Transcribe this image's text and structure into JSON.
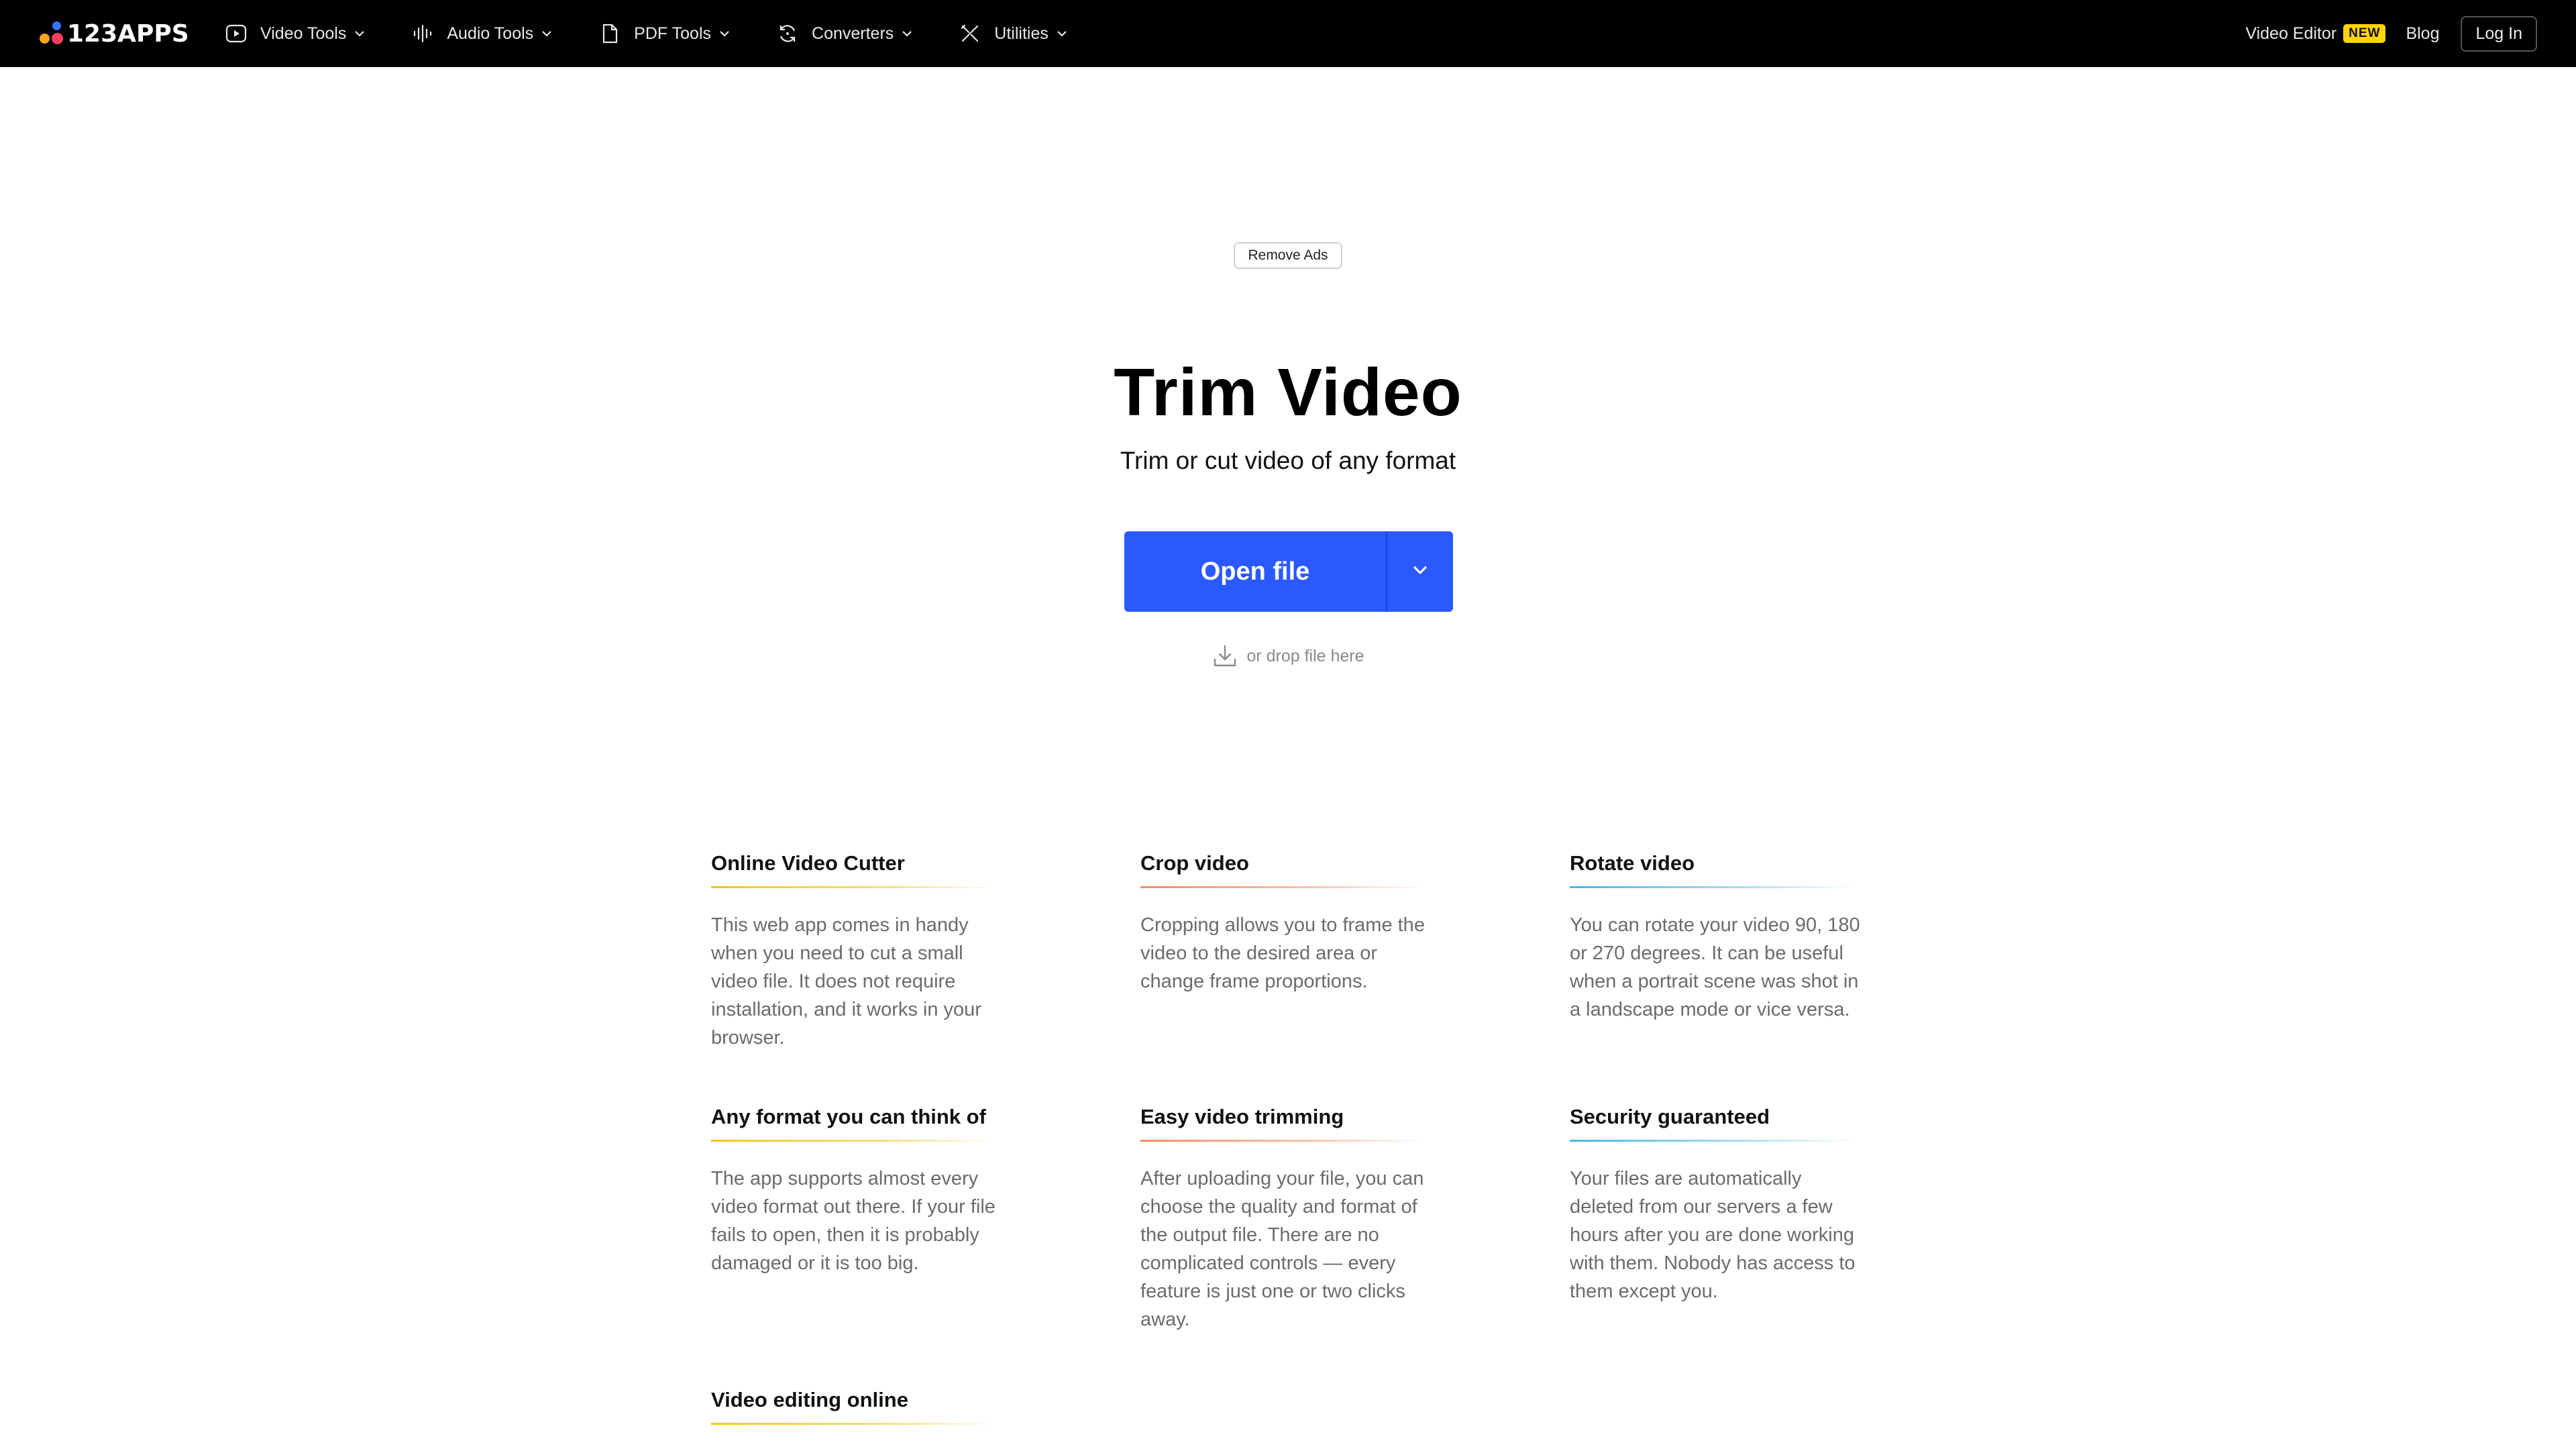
{
  "nav": {
    "logo": "123APPS",
    "menu": [
      {
        "label": "Video Tools",
        "icon": "video-play-icon"
      },
      {
        "label": "Audio Tools",
        "icon": "audio-wave-icon"
      },
      {
        "label": "PDF Tools",
        "icon": "document-icon"
      },
      {
        "label": "Converters",
        "icon": "convert-cycle-icon"
      },
      {
        "label": "Utilities",
        "icon": "tools-icon"
      }
    ],
    "video_editor": "Video Editor",
    "new_badge": "NEW",
    "blog": "Blog",
    "login": "Log In"
  },
  "hero": {
    "remove_ads": "Remove Ads",
    "title": "Trim Video",
    "subtitle": "Trim or cut video of any format",
    "open_file": "Open file",
    "drop_hint": "or drop file here"
  },
  "features": [
    {
      "title": "Online Video Cutter",
      "text": "This web app comes in handy when you need to cut a small video file. It does not require installation, and it works in your browser."
    },
    {
      "title": "Crop video",
      "text": "Cropping allows you to frame the video to the desired area or change frame proportions."
    },
    {
      "title": "Rotate video",
      "text": "You can rotate your video 90, 180 or 270 degrees. It can be useful when a portrait scene was shot in a landscape mode or vice versa."
    },
    {
      "title": "Any format you can think of",
      "text": "The app supports almost every video format out there. If your file fails to open, then it is probably damaged or it is too big."
    },
    {
      "title": "Easy video trimming",
      "text": "After uploading your file, you can choose the quality and format of the output file. There are no complicated controls — every feature is just one or two clicks away."
    },
    {
      "title": "Security guaranteed",
      "text": "Your files are automatically deleted from our servers a few hours after you are done working with them. Nobody has access to them except you."
    },
    {
      "title": "Video editing online",
      "text": ""
    }
  ],
  "colors": {
    "accent_blue": "#2a59fe",
    "badge_yellow": "#ffd600",
    "underline_yellow": "#f5c518",
    "underline_orange": "#f58a5f",
    "underline_blue": "#45b6e8"
  }
}
